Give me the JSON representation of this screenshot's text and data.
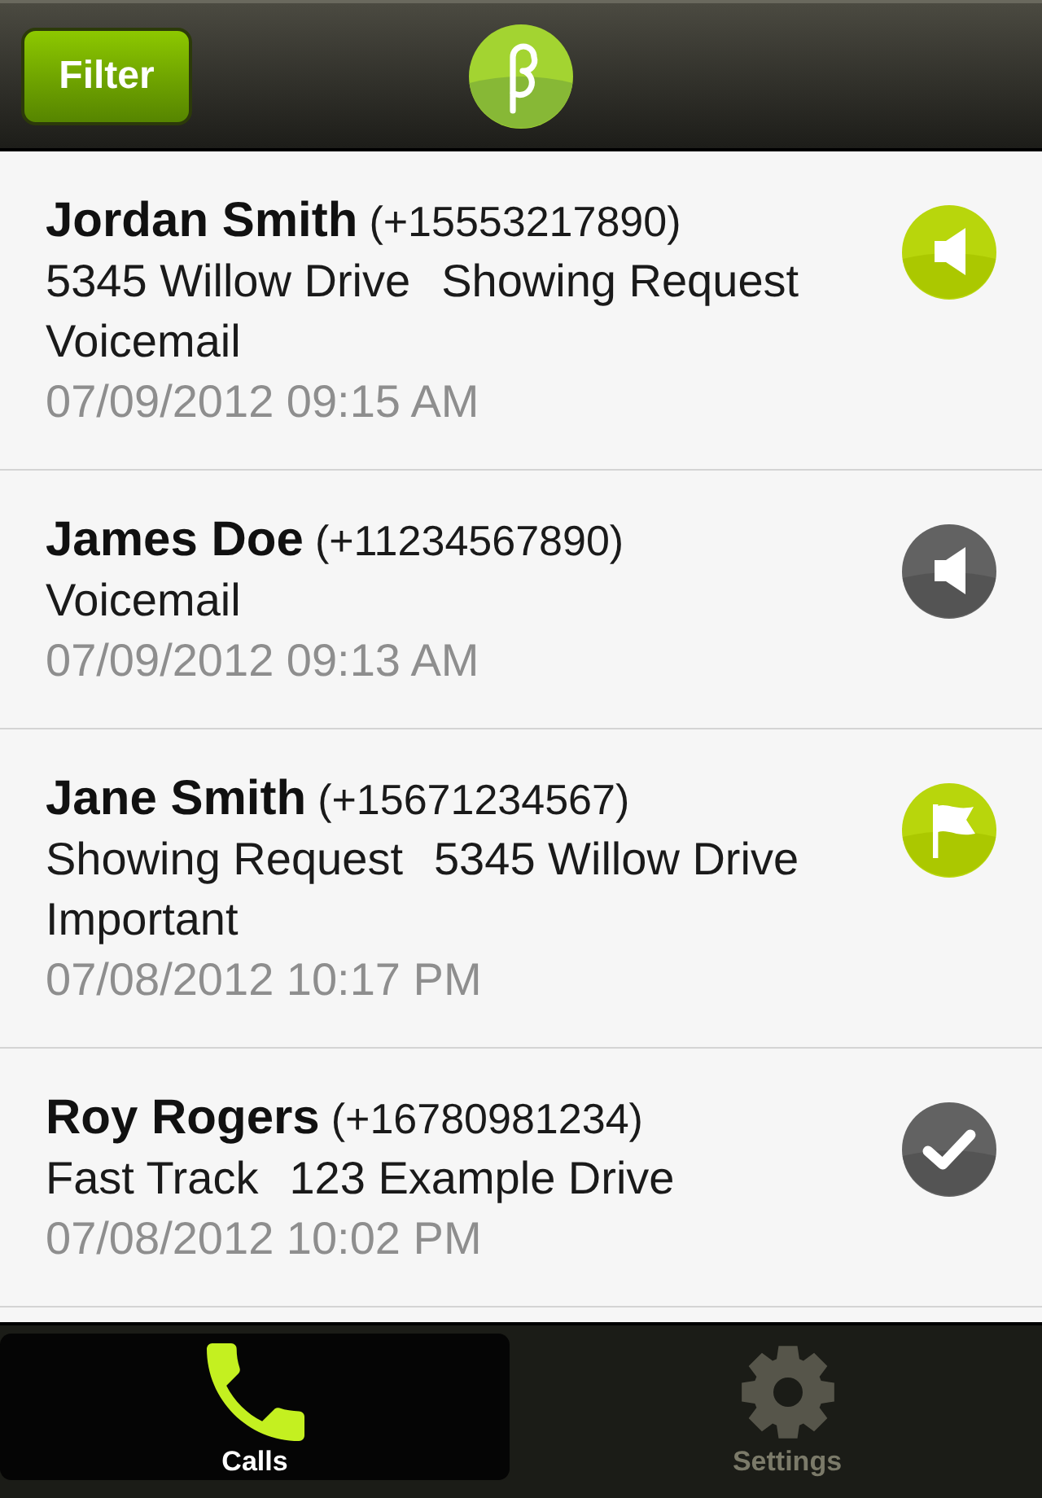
{
  "header": {
    "filter_button": "Filter"
  },
  "calls": [
    {
      "name": "Jordan Smith",
      "phone": "(+15553217890)",
      "tags": [
        "5345 Willow Drive",
        "Showing Request",
        "Voicemail"
      ],
      "timestamp": "07/09/2012 09:15 AM",
      "kind": "voicemail",
      "highlighted": true
    },
    {
      "name": "James Doe",
      "phone": "(+11234567890)",
      "tags": [
        "Voicemail"
      ],
      "timestamp": "07/09/2012 09:13 AM",
      "kind": "voicemail",
      "highlighted": false
    },
    {
      "name": "Jane Smith",
      "phone": "(+15671234567)",
      "tags": [
        "Showing Request",
        "5345 Willow Drive",
        "Important"
      ],
      "timestamp": "07/08/2012 10:17 PM",
      "kind": "flag",
      "highlighted": true
    },
    {
      "name": "Roy Rogers",
      "phone": "(+16780981234)",
      "tags": [
        "Fast Track",
        "123 Example Drive"
      ],
      "timestamp": "07/08/2012 10:02 PM",
      "kind": "check",
      "highlighted": false
    }
  ],
  "tabs": [
    {
      "label": "Calls",
      "selected": true
    },
    {
      "label": "Settings",
      "selected": false
    }
  ]
}
